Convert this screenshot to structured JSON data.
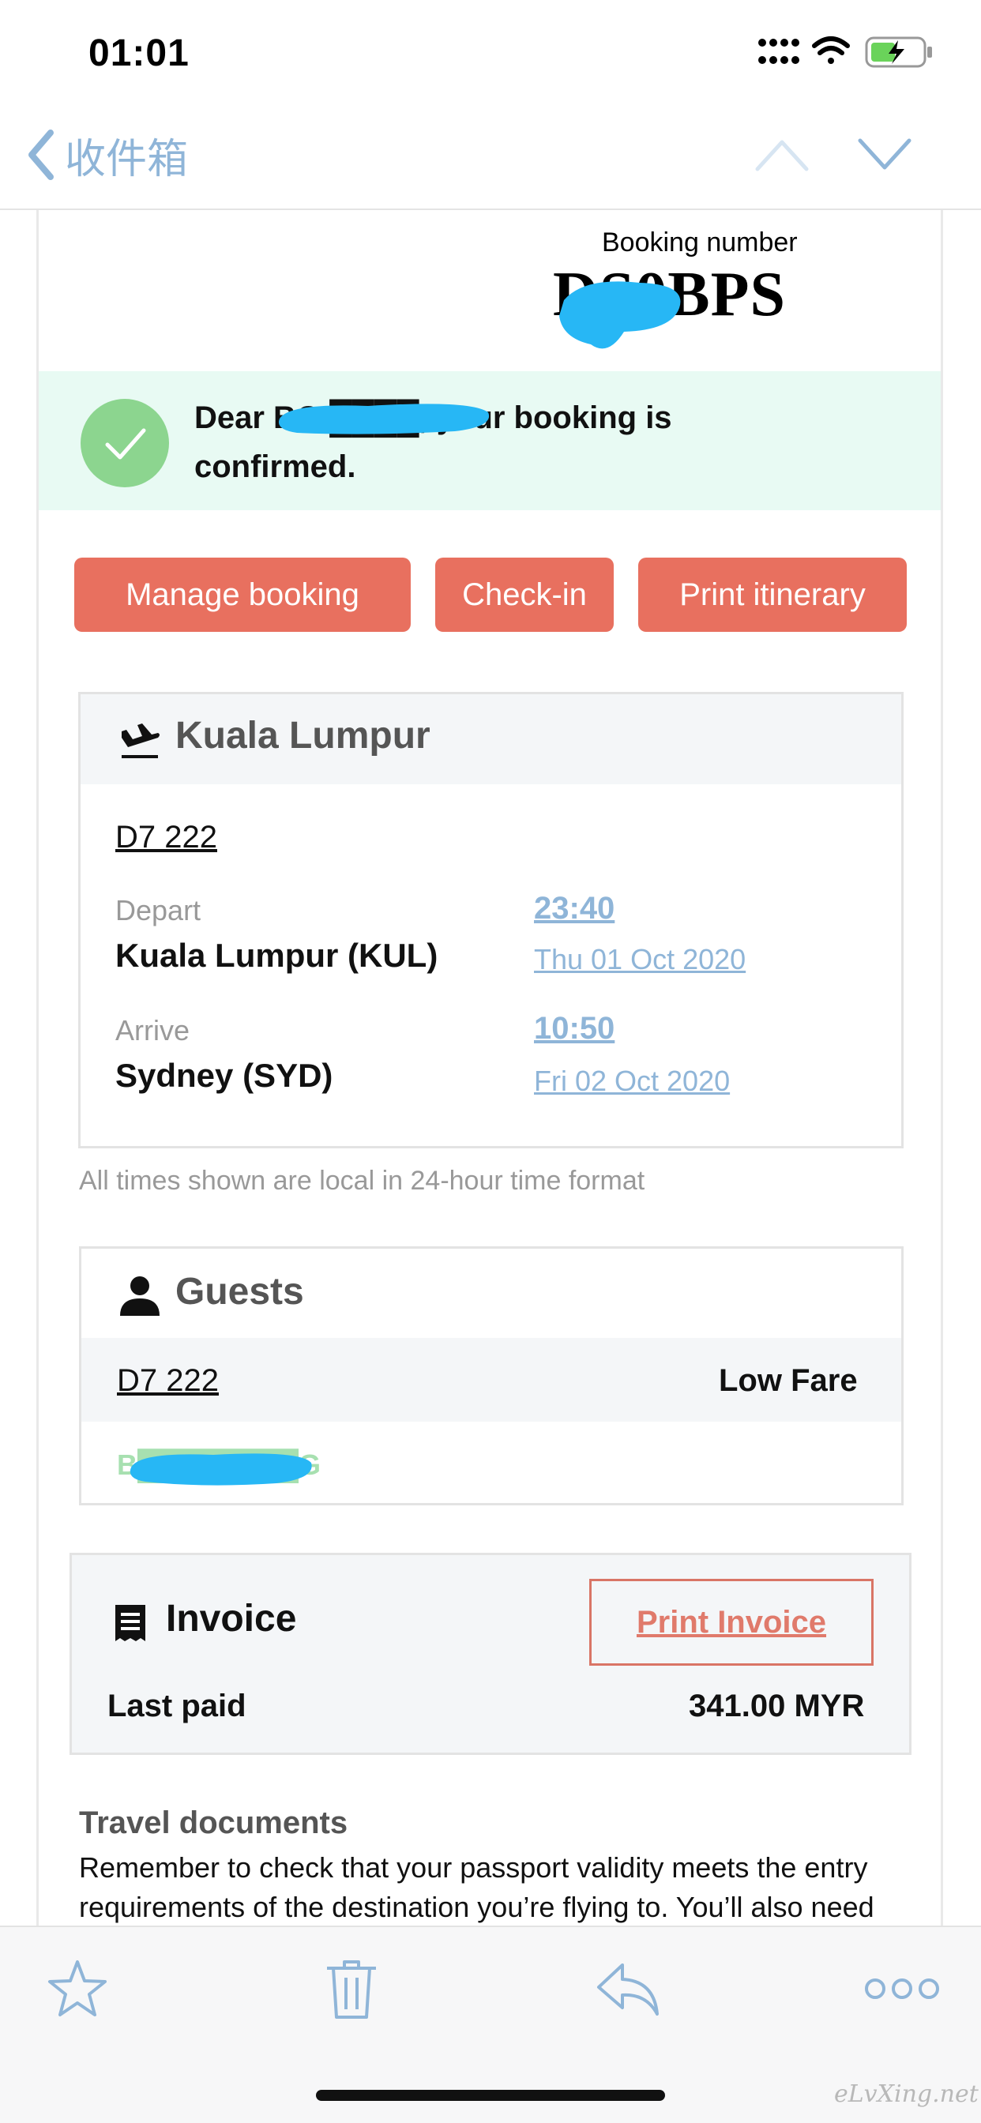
{
  "status_bar": {
    "time": "01:01"
  },
  "nav": {
    "back_label": "收件箱"
  },
  "email": {
    "booking_label": "Booking number",
    "booking_value": "DS0BPS",
    "confirmation": {
      "text": "Dear BOI████, your booking is confirmed."
    },
    "actions": {
      "manage": "Manage booking",
      "checkin": "Check-in",
      "print": "Print itinerary"
    },
    "flight": {
      "title": "Kuala Lumpur",
      "number": "D7 222",
      "depart_label": "Depart",
      "depart_city": "Kuala Lumpur (KUL)",
      "depart_time": "23:40",
      "depart_date": "Thu 01 Oct 2020",
      "arrive_label": "Arrive",
      "arrive_city": "Sydney (SYD)",
      "arrive_time": "10:50",
      "arrive_date": "Fri 02 Oct 2020",
      "note": "All times shown are local in 24-hour time format"
    },
    "guests": {
      "title": "Guests",
      "flight": "D7 222",
      "fare": "Low Fare",
      "name": "B████████G"
    },
    "invoice": {
      "title": "Invoice",
      "print_label": "Print Invoice",
      "last_paid_label": "Last paid",
      "last_paid_value": "341.00 MYR"
    },
    "travel_docs": {
      "title": "Travel documents",
      "text": "Remember to check that your passport validity meets the entry requirements of the destination you’re flying to. You’ll also need"
    }
  },
  "watermark": "eLvXing.net",
  "colors": {
    "accent": "#e8705f",
    "link": "#8fb5d8",
    "banner": "#e8faf3",
    "check": "#8cd58f",
    "redaction": "#27b7f5"
  }
}
